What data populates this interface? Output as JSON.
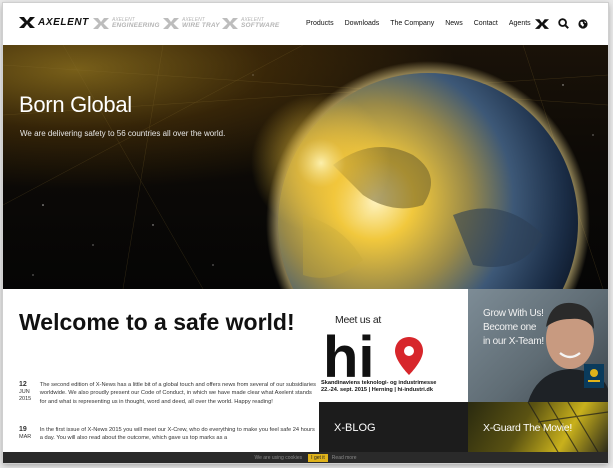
{
  "header": {
    "brands": [
      {
        "top": "",
        "bottom": "AXELENT"
      },
      {
        "top": "AXELENT",
        "bottom": "ENGINEERING"
      },
      {
        "top": "AXELENT",
        "bottom": "WIRE TRAY"
      },
      {
        "top": "AXELENT",
        "bottom": "SOFTWARE"
      }
    ],
    "nav": [
      "Products",
      "Downloads",
      "The Company",
      "News",
      "Contact",
      "Agents"
    ],
    "icons": [
      "axelent-x-icon",
      "search-icon",
      "globe-icon"
    ]
  },
  "hero": {
    "title": "Born Global",
    "subtitle": "We are delivering safety to 56 countries all over the world."
  },
  "main": {
    "heading": "Welcome to a safe world!",
    "news": [
      {
        "day": "12",
        "month": "JUN",
        "year": "2015",
        "text": "The second edition of X-News has a little bit of a global touch and offers news from several of our subsidiaries worldwide. We also proudly present our Code of Conduct, in which we have made clear what Axelent stands for and what is representing us in thought, word and deed, all over the world. Happy reading!"
      },
      {
        "day": "19",
        "month": "MAR",
        "year": "",
        "text": "In the first issue of X-News 2015 you will meet our X-Crew, who do everything to make you feel safe 24 hours a day. You will also read about the outcome, which gave us top marks as a"
      }
    ]
  },
  "tiles": {
    "meet": {
      "title": "Meet us at",
      "logo_text": "hi",
      "caption_line1": "Skandinaviens teknologi- og industrimesse",
      "caption_line2": "22.-24. sept. 2015 | Herning | hi-industri.dk"
    },
    "grow": {
      "line1": "Grow With Us!",
      "line2": "Become one",
      "line3": "in our X-Team!"
    },
    "blog": {
      "title": "X-BLOG"
    },
    "movie": {
      "title": "X-Guard The Movie!"
    }
  },
  "cookie": {
    "message": "We are using cookies",
    "accept": "I get it",
    "more": "Read more"
  },
  "colors": {
    "accent": "#e0b31a",
    "pin_red": "#d7262b",
    "text_dark": "#111111"
  }
}
